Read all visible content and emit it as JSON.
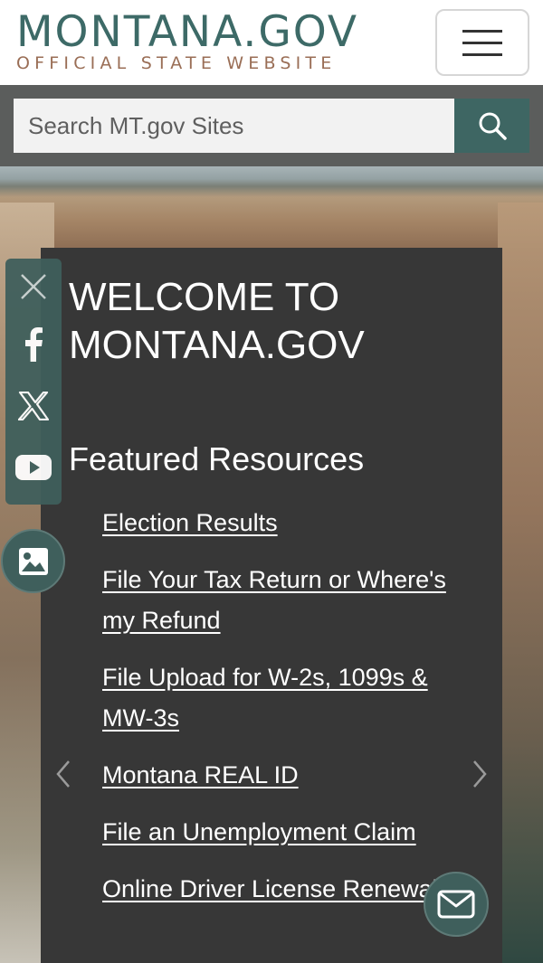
{
  "header": {
    "logo_main": "MONTANA.GOV",
    "logo_sub": "OFFICIAL STATE WEBSITE",
    "menu_icon": "hamburger-icon"
  },
  "search": {
    "placeholder": "Search MT.gov Sites",
    "button_icon": "search-icon"
  },
  "welcome": {
    "title": "WELCOME TO\nMONTANA.GOV",
    "subtitle": "Featured Resources",
    "resources": [
      "Election Results",
      "File Your Tax Return or Where's my Refund",
      "File Upload for W-2s, 1099s & MW-3s",
      "Montana REAL ID",
      "File an Unemployment Claim",
      "Online Driver License Renewal"
    ],
    "prev_icon": "chevron-left-icon",
    "next_icon": "chevron-right-icon"
  },
  "social": {
    "items": [
      "close-icon",
      "facebook-icon",
      "x-icon",
      "youtube-icon"
    ]
  },
  "floating": {
    "photo_icon": "image-icon",
    "mail_icon": "mail-icon"
  },
  "colors": {
    "brand_teal": "#3e6663",
    "logo_brown": "#9a6e56",
    "panel_bg": "#373737",
    "search_bar_bg": "#5b5d5c"
  }
}
